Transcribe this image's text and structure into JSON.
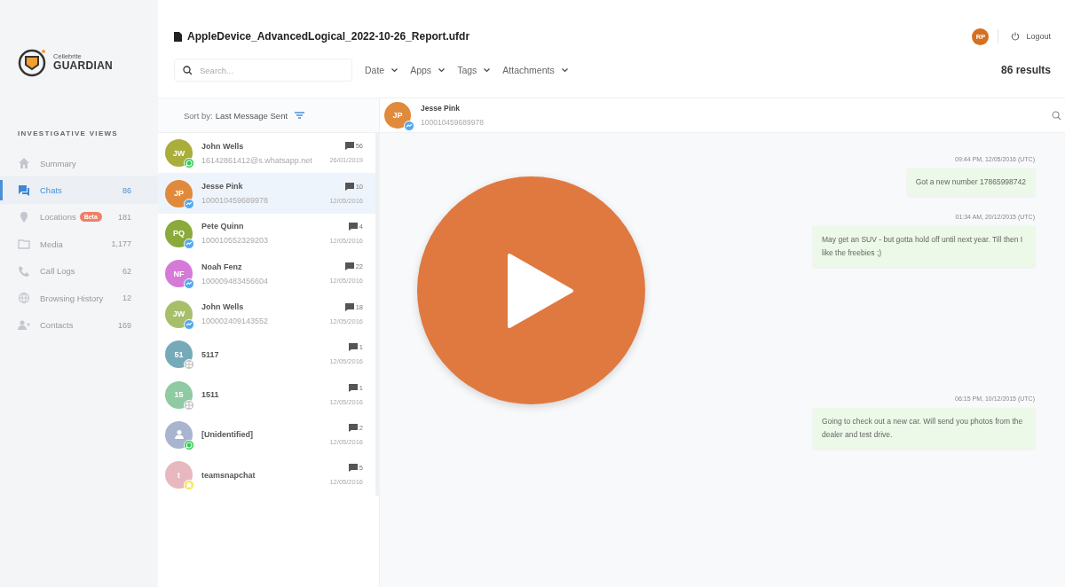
{
  "brand": {
    "small": "Cellebrite",
    "name": "GUARDIAN"
  },
  "header": {
    "file_name": "AppleDevice_AdvancedLogical_2022-10-26_Report.ufdr",
    "user_initials": "RP",
    "logout": "Logout",
    "search": {
      "placeholder": "Search..."
    },
    "filters": [
      "Date",
      "Apps",
      "Tags",
      "Attachments"
    ],
    "results": "86 results"
  },
  "sidebar": {
    "heading": "INVESTIGATIVE VIEWS",
    "items": [
      {
        "label": "Summary",
        "selected": false
      },
      {
        "label": "Chats",
        "count": "86",
        "selected": true
      },
      {
        "label": "Locations",
        "badge": "Beta",
        "count": "181",
        "selected": false
      },
      {
        "label": "Media",
        "count": "1,177",
        "selected": false
      },
      {
        "label": "Call Logs",
        "count": "62",
        "selected": false
      },
      {
        "label": "Browsing History",
        "count": "12",
        "selected": false
      },
      {
        "label": "Contacts",
        "count": "169",
        "selected": false
      }
    ]
  },
  "chat_list": {
    "sort_label": "Sort by:",
    "sort_value": "Last Message Sent",
    "chats": [
      {
        "initials": "JW",
        "color": "#a9ad3a",
        "kind": "whatsapp",
        "name": "John Wells",
        "id": "16142861412@s.whatsapp.net",
        "count": "56",
        "date": "26/01/2019",
        "selected": false
      },
      {
        "initials": "JP",
        "color": "#e08a3c",
        "kind": "messenger",
        "name": "Jesse Pink",
        "id": "100010459689978",
        "count": "10",
        "date": "12/05/2016",
        "selected": true
      },
      {
        "initials": "PQ",
        "color": "#8aaa3c",
        "kind": "messenger",
        "name": "Pete Quinn",
        "id": "100010552329203",
        "count": "4",
        "date": "12/05/2016",
        "selected": false
      },
      {
        "initials": "NF",
        "color": "#d67ad8",
        "kind": "messenger",
        "name": "Noah Fenz",
        "id": "100009483456604",
        "count": "22",
        "date": "12/05/2016",
        "selected": false
      },
      {
        "initials": "JW",
        "color": "#a7bf6a",
        "kind": "messenger",
        "name": "John Wells",
        "id": "100002409143552",
        "count": "18",
        "date": "12/05/2016",
        "selected": false
      },
      {
        "initials": "51",
        "color": "#76aab8",
        "kind": "sms",
        "name": "5117",
        "count": "1",
        "date": "12/05/2016",
        "selected": false
      },
      {
        "initials": "15",
        "color": "#8fcaa2",
        "kind": "sms",
        "name": "1511",
        "count": "1",
        "date": "12/05/2016",
        "selected": false
      },
      {
        "color": "#a9b4d0",
        "kind": "whatsapp",
        "name": "[Unidentified]",
        "count": "2",
        "date": "12/05/2016",
        "selected": false
      },
      {
        "initials": "t",
        "color": "#e8b8c0",
        "kind": "snapchat",
        "name": "teamsnapchat",
        "count": "5",
        "date": "12/05/2016",
        "selected": false
      }
    ]
  },
  "conversation": {
    "contact": {
      "initials": "JP",
      "name": "Jesse Pink",
      "id": "100010459689978"
    },
    "messages": [
      {
        "time": "09:44 PM, 12/05/2016 (UTC)",
        "text": "Got a new number 17865998742"
      },
      {
        "time": "01:34 AM, 20/12/2015 (UTC)",
        "text": "May get an SUV - but gotta hold off until next year. Till then I like the freebies ;)"
      },
      {
        "time": "06:15 PM, 10/12/2015 (UTC)",
        "text": "Going to check out a new car. Will send you photos from the dealer and test drive."
      }
    ]
  }
}
